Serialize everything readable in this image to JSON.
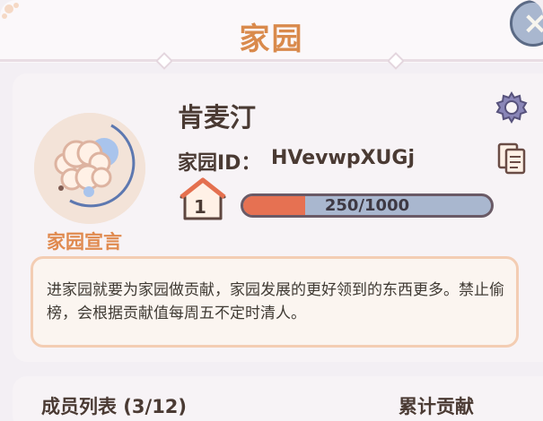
{
  "header": {
    "title": "家园"
  },
  "profile": {
    "name": "肯麦汀",
    "home_id_label": "家园ID：",
    "home_id_value": "HVevwpXUGj",
    "level": "1",
    "progress_text": "250/1000",
    "progress_fraction": 0.25,
    "declaration_label": "家园宣言"
  },
  "declaration": {
    "text": "进家园就要为家园做贡献，家园发展的更好领到的东西更多。禁止偷榜，会根据贡献值每周五不定时清人。"
  },
  "members": {
    "list_label": "成员列表 (3/12)",
    "contribution_label": "累计贡献"
  },
  "icons": {
    "close": "close-icon",
    "settings": "gear-icon",
    "copy": "copy-icon",
    "level": "house-level-icon"
  },
  "colors": {
    "accent_orange": "#d98a4c",
    "progress_fill": "#e67152",
    "progress_track": "#a9b7cf",
    "text_dark": "#4a3a33"
  }
}
